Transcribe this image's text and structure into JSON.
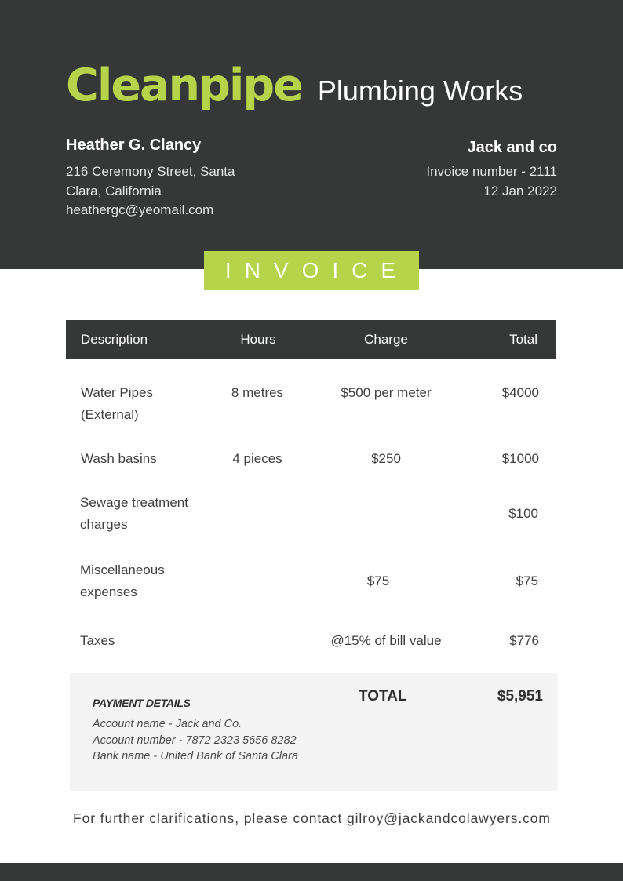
{
  "colors": {
    "accent": "#b5d44a",
    "dark": "#363737",
    "summary_bg": "#f4f4f4"
  },
  "brand": {
    "name": "Cleanpipe",
    "tagline": "Plumbing Works"
  },
  "from": {
    "name": "Heather G. Clancy",
    "address_line1": "216 Ceremony Street, Santa",
    "address_line2": "Clara, California",
    "email": "heathergc@yeomail.com"
  },
  "to": {
    "name": "Jack and co",
    "invoice_number": "Invoice number - 2111",
    "date": "12 Jan 2022"
  },
  "invoice_label": "INVOICE",
  "table": {
    "headers": {
      "description": "Description",
      "hours": "Hours",
      "charge": "Charge",
      "total": "Total"
    },
    "rows": [
      {
        "description": [
          "Water Pipes",
          "(External)"
        ],
        "hours": "8 metres",
        "charge": "$500 per meter",
        "total": "$4000"
      },
      {
        "description": [
          "Wash basins"
        ],
        "hours": "4 pieces",
        "charge": "$250",
        "total": "$1000"
      },
      {
        "description": [
          "Sewage treatment",
          "charges"
        ],
        "hours": "",
        "charge": "",
        "total": "$100"
      },
      {
        "description": [
          "Miscellaneous",
          "expenses"
        ],
        "hours": "",
        "charge": "$75",
        "total": "$75"
      },
      {
        "description": [
          "Taxes"
        ],
        "hours": "",
        "charge": "@15% of bill value",
        "total": "$776"
      }
    ]
  },
  "payment": {
    "title": "PAYMENT DETAILS",
    "account_name": "Account name - Jack and Co.",
    "account_number": "Account number - 7872 2323 5656 8282",
    "bank_name": "Bank name - United Bank of Santa Clara"
  },
  "totals": {
    "label": "TOTAL",
    "value": "$5,951"
  },
  "footer": {
    "contact": "For further clarifications, please contact gilroy@jackandcolawyers.com"
  }
}
